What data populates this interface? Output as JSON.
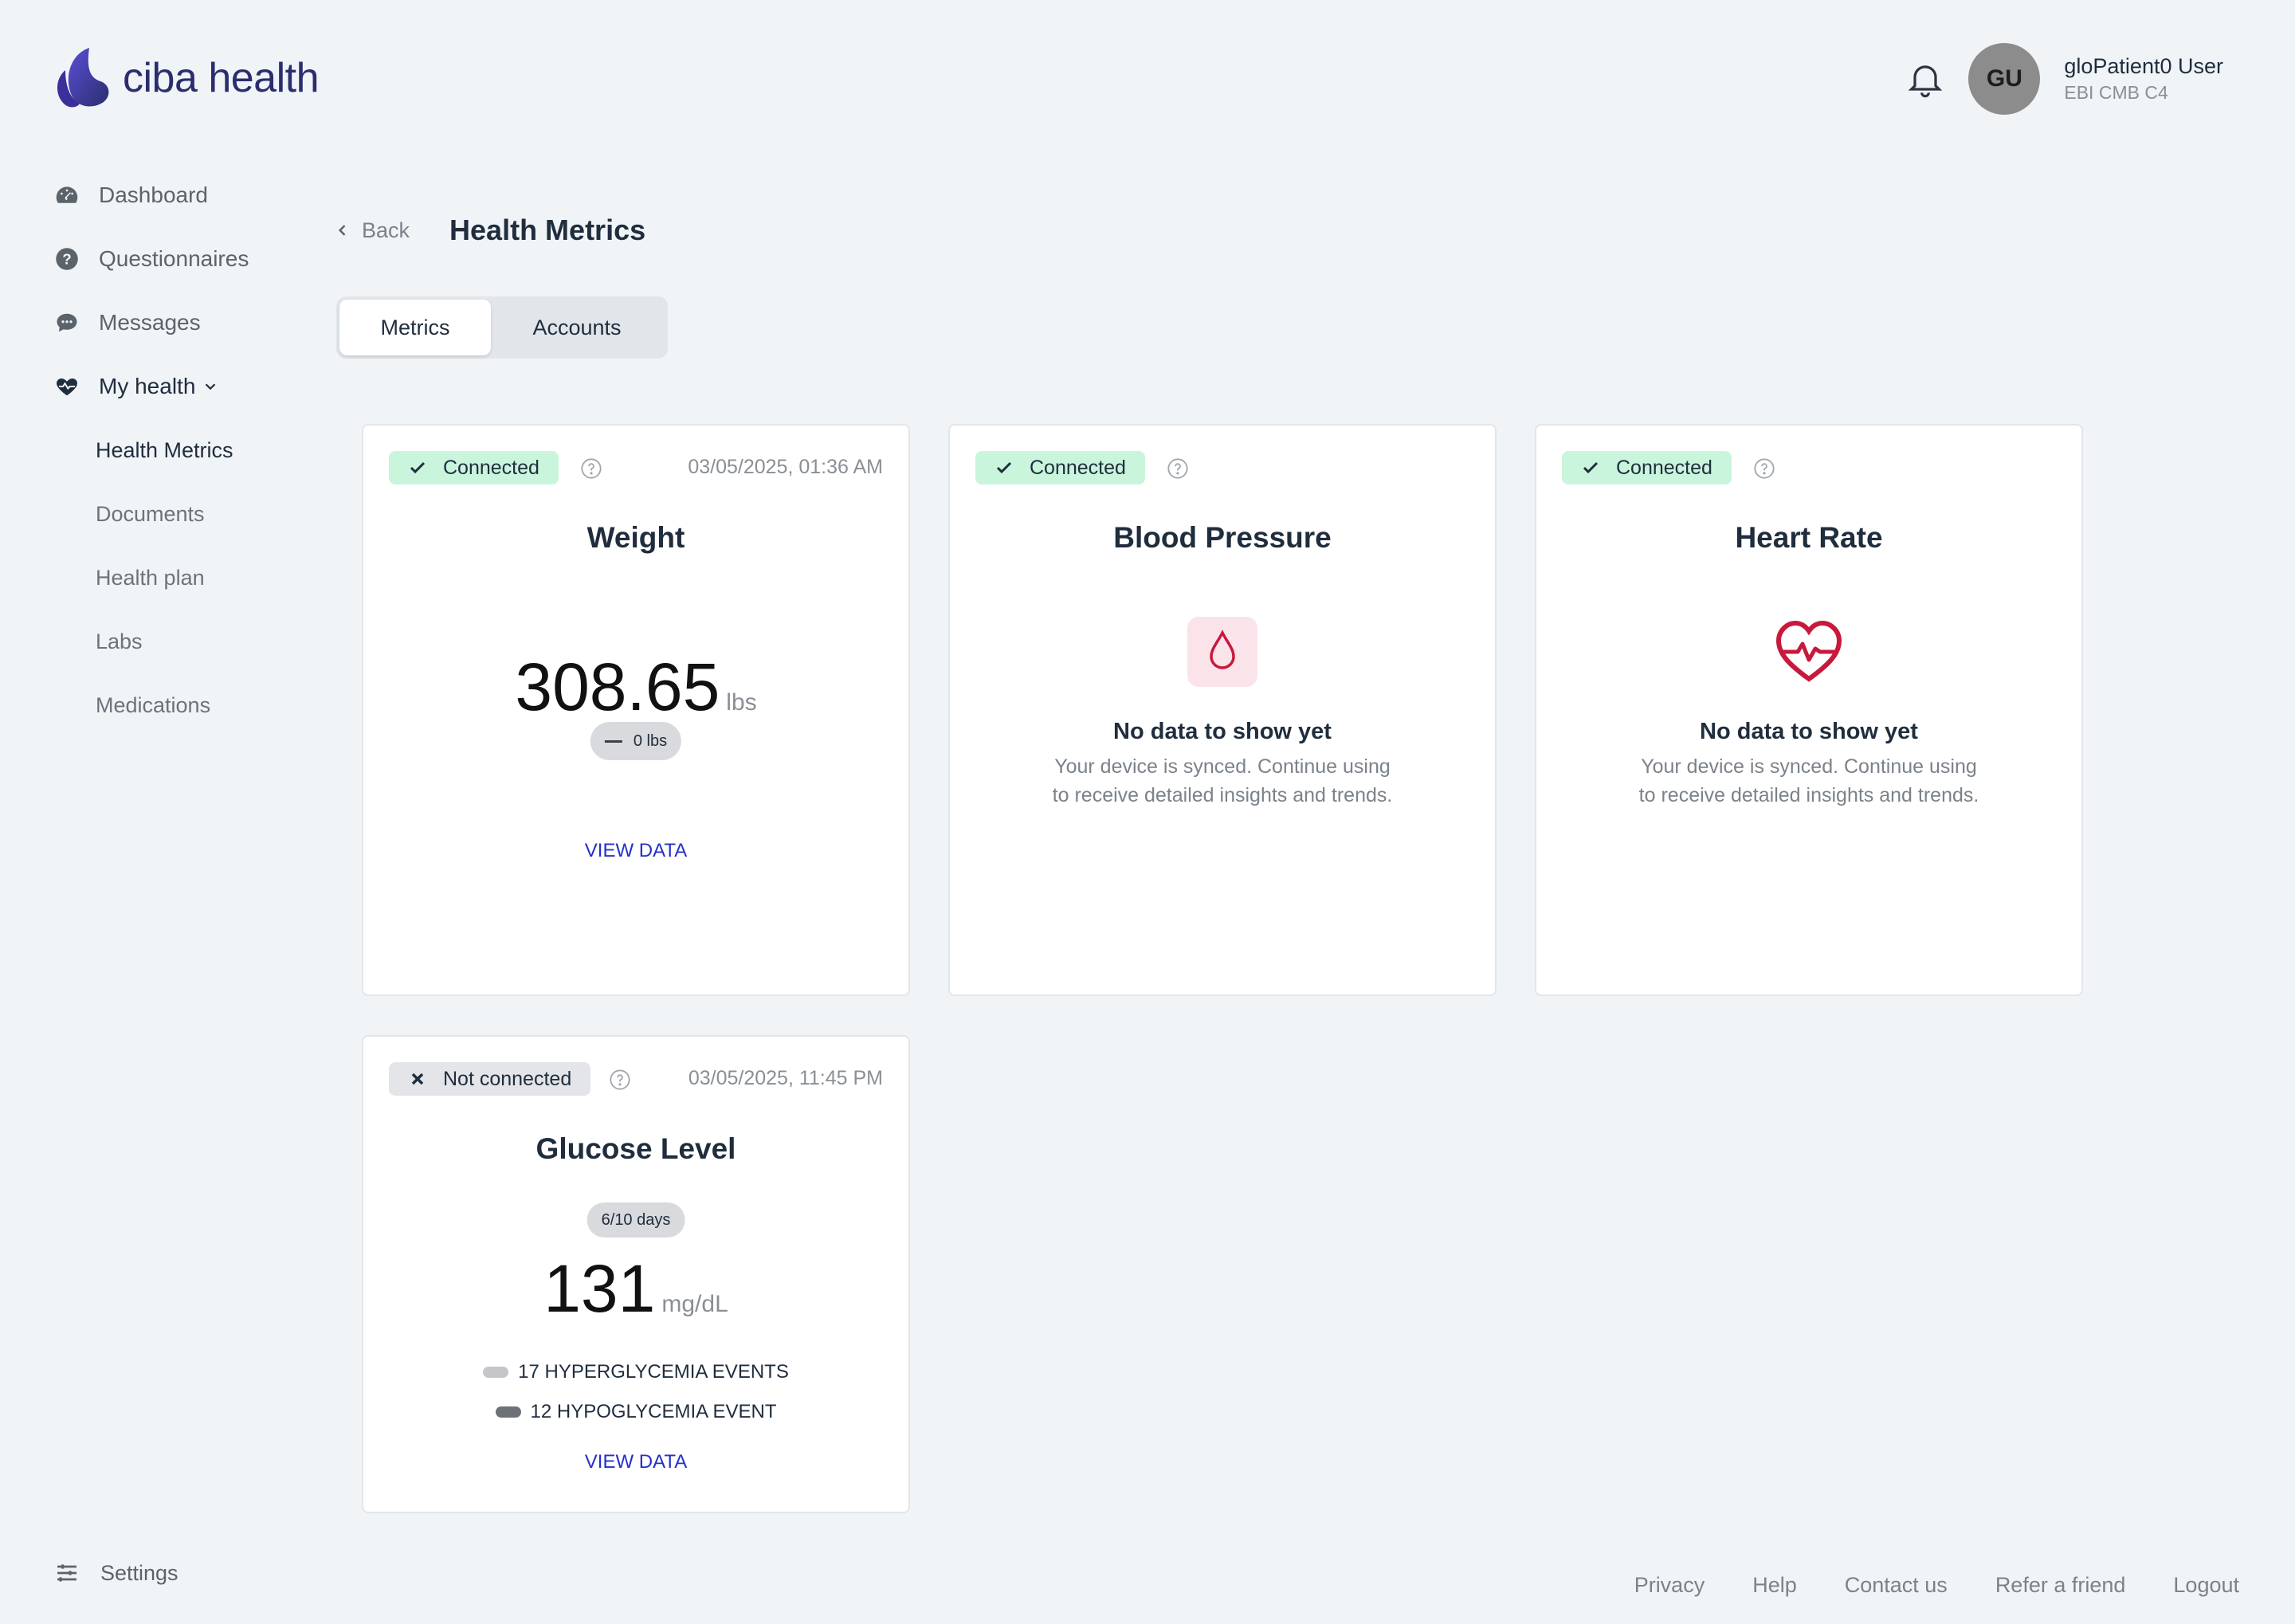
{
  "brand": {
    "name": "ciba health",
    "logo_color": "#3b2f9a"
  },
  "header": {
    "avatar_initials": "GU",
    "user_name": "gloPatient0 User",
    "user_sub": "EBI CMB C4"
  },
  "sidebar": {
    "items": [
      {
        "label": "Dashboard",
        "icon": "gauge-icon"
      },
      {
        "label": "Questionnaires",
        "icon": "question-icon"
      },
      {
        "label": "Messages",
        "icon": "chat-icon"
      },
      {
        "label": "My health",
        "icon": "heart-pulse-icon"
      }
    ],
    "sub_items": [
      {
        "label": "Health Metrics"
      },
      {
        "label": "Documents"
      },
      {
        "label": "Health plan"
      },
      {
        "label": "Labs"
      },
      {
        "label": "Medications"
      }
    ],
    "settings_label": "Settings"
  },
  "page": {
    "back_label": "Back",
    "title": "Health Metrics",
    "tabs": [
      {
        "label": "Metrics"
      },
      {
        "label": "Accounts"
      }
    ]
  },
  "cards": {
    "weight": {
      "status": "Connected",
      "timestamp": "03/05/2025, 01:36 AM",
      "title": "Weight",
      "value": "308.65",
      "unit": "lbs",
      "change": "0 lbs",
      "link": "VIEW DATA"
    },
    "blood_pressure": {
      "status": "Connected",
      "title": "Blood Pressure",
      "empty_title": "No data to show yet",
      "empty_text": "Your device is synced. Continue using to receive detailed insights and trends."
    },
    "heart_rate": {
      "status": "Connected",
      "title": "Heart Rate",
      "empty_title": "No data to show yet",
      "empty_text": "Your device is synced. Continue using to receive detailed insights and trends."
    },
    "glucose": {
      "status": "Not connected",
      "timestamp": "03/05/2025, 11:45 PM",
      "title": "Glucose Level",
      "days_pill": "6/10 days",
      "value": "131",
      "unit": "mg/dL",
      "events": [
        {
          "label": "17 HYPERGLYCEMIA EVENTS",
          "color": "#c4c6c9"
        },
        {
          "label": "12 HYPOGLYCEMIA EVENT",
          "color": "#6e7276"
        }
      ],
      "link": "VIEW DATA"
    }
  },
  "colors": {
    "connected_bg": "#c9f5dc",
    "link": "#2530c8",
    "heart": "#c8193c"
  },
  "footer": {
    "links": [
      {
        "label": "Privacy"
      },
      {
        "label": "Help"
      },
      {
        "label": "Contact us"
      },
      {
        "label": "Refer a friend"
      },
      {
        "label": "Logout"
      }
    ]
  }
}
